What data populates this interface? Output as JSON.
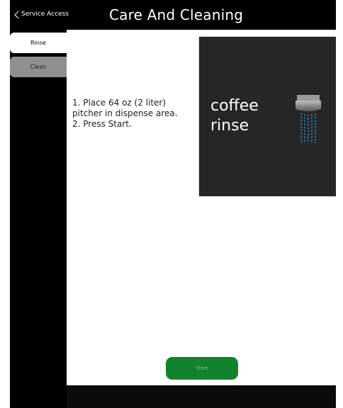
{
  "header": {
    "back_label": "Service Access",
    "title": "Care And Cleaning"
  },
  "sidebar": {
    "items": [
      {
        "label": "Rinse",
        "selected": true
      },
      {
        "label": "Clean",
        "selected": false
      }
    ]
  },
  "main": {
    "instructions": [
      "1. Place 64 oz (2 liter) pitcher in dispense area.",
      "2. Press Start."
    ],
    "illustration": {
      "line1": "coffee",
      "line2": "rinse",
      "icon": "coffee-dispense-icon"
    },
    "start_label": "Start"
  },
  "colors": {
    "background": "#000000",
    "panel": "#ffffff",
    "accent_green": "#12822f",
    "tab_inactive": "#8f8f8f",
    "illustration_bg": "#262626"
  }
}
